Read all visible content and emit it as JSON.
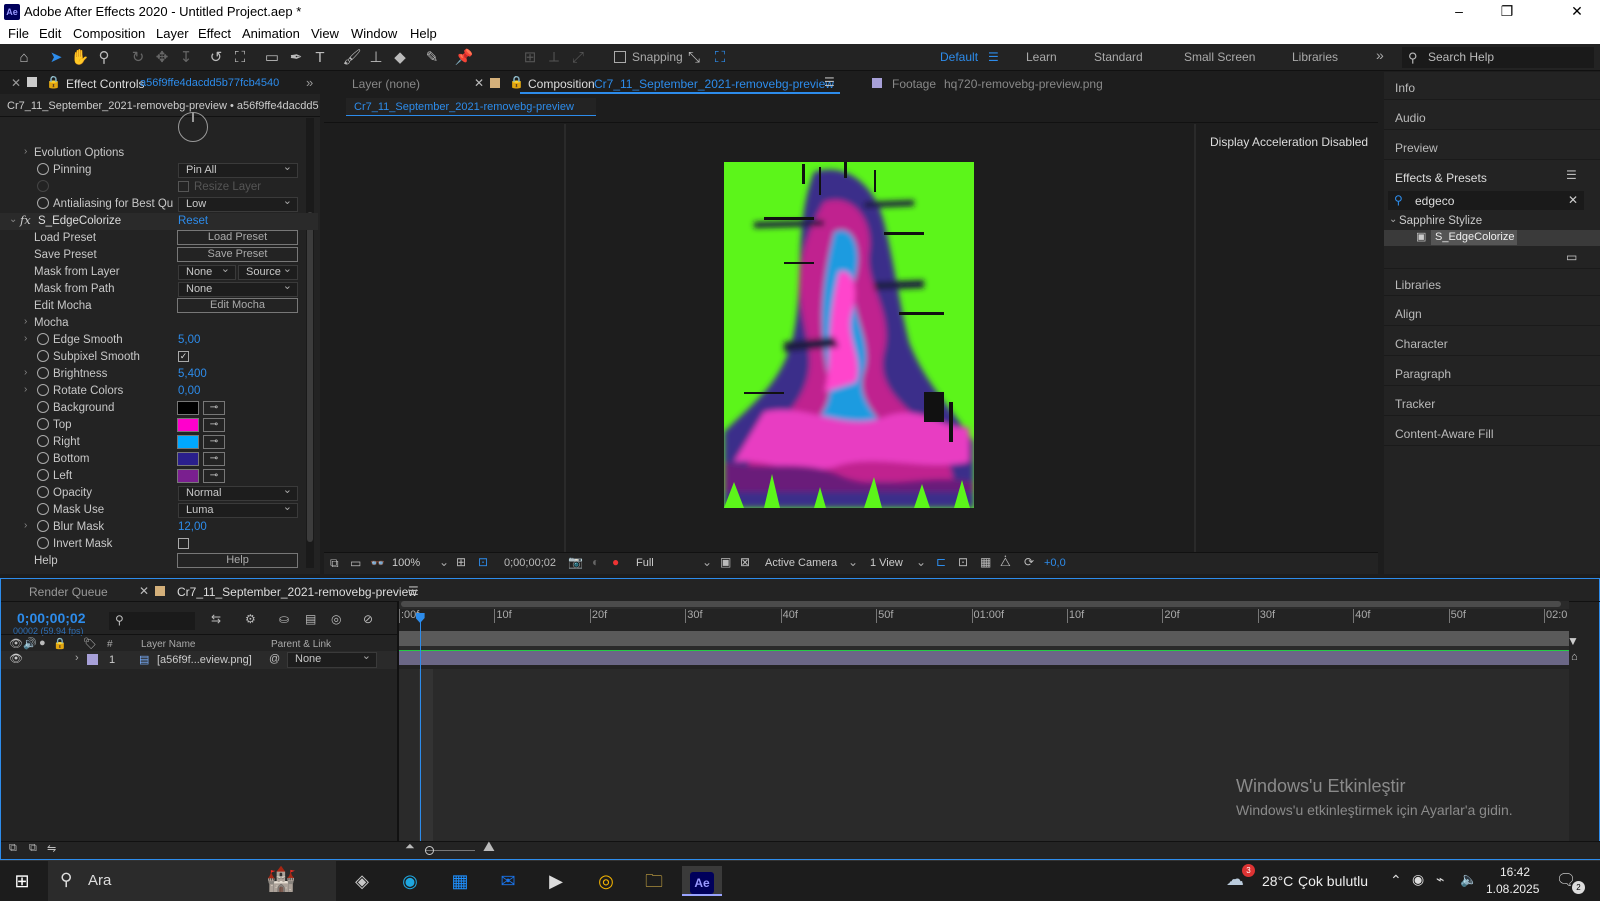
{
  "window": {
    "title": "Adobe After Effects 2020 - Untitled Project.aep *",
    "app_badge": "Ae",
    "minimize": "–",
    "maximize": "❐",
    "close": "✕"
  },
  "menu": [
    "File",
    "Edit",
    "Composition",
    "Layer",
    "Effect",
    "Animation",
    "View",
    "Window",
    "Help"
  ],
  "toolbar": {
    "snapping_label": "Snapping",
    "workspaces": [
      "Default",
      "Learn",
      "Standard",
      "Small Screen",
      "Libraries"
    ],
    "search_help_placeholder": "Search Help",
    "more": "»"
  },
  "effect_controls": {
    "tab_label": "Effect Controls",
    "tab_layer": "a56f9ffe4dacdd5b77fcb4540",
    "header": "Cr7_11_September_2021-removebg-preview • a56f9ffe4dacdd5",
    "rows": {
      "evolution_options": "Evolution Options",
      "pinning": "Pinning",
      "pinning_value": "Pin All",
      "resize_layer": "Resize Layer",
      "antialiasing": "Antialiasing for Best Qu",
      "antialiasing_value": "Low",
      "effect_name": "S_EdgeColorize",
      "reset": "Reset",
      "fx": "fx",
      "load_preset": "Load Preset",
      "save_preset": "Save Preset",
      "mask_from_layer": "Mask from Layer",
      "mask_layer_value": "None",
      "mask_source_value": "Source",
      "mask_from_path": "Mask from Path",
      "mask_path_value": "None",
      "edit_mocha": "Edit Mocha",
      "mocha": "Mocha",
      "edge_smooth": "Edge Smooth",
      "edge_smooth_value": "5,00",
      "subpixel_smooth": "Subpixel Smooth",
      "brightness": "Brightness",
      "brightness_value": "5,400",
      "rotate_colors": "Rotate Colors",
      "rotate_colors_value": "0,00",
      "background": "Background",
      "top": "Top",
      "right": "Right",
      "bottom": "Bottom",
      "left": "Left",
      "opacity": "Opacity",
      "opacity_value": "Normal",
      "mask_use": "Mask Use",
      "mask_use_value": "Luma",
      "blur_mask": "Blur Mask",
      "blur_mask_value": "12,00",
      "invert_mask": "Invert Mask",
      "help": "Help"
    },
    "colors": {
      "background": "#000000",
      "top": "#ff00cc",
      "right": "#00a8ff",
      "bottom": "#2a1f8c",
      "left": "#7a1f8f"
    }
  },
  "viewer": {
    "tab_layer": "Layer (none)",
    "tab_composition_prefix": "Composition",
    "tab_composition_name": "Cr7_11_September_2021-removebg-preview",
    "tab_footage_prefix": "Footage",
    "tab_footage_name": "hq720-removebg-preview.png",
    "subtab": "Cr7_11_September_2021-removebg-preview",
    "display_accel": "Display Acceleration Disabled",
    "zoom": "100%",
    "timecode": "0;00;00;02",
    "resolution": "Full",
    "camera": "Active Camera",
    "views": "1 View",
    "exposure": "+0,0"
  },
  "right_panels": {
    "info": "Info",
    "audio": "Audio",
    "preview": "Preview",
    "effects_presets": "Effects & Presets",
    "search_value": "edgeco",
    "category": "Sapphire Stylize",
    "result": "S_EdgeColorize",
    "libraries": "Libraries",
    "align": "Align",
    "character": "Character",
    "paragraph": "Paragraph",
    "tracker": "Tracker",
    "content_aware_fill": "Content-Aware Fill"
  },
  "timeline": {
    "tab_render_queue": "Render Queue",
    "tab_comp": "Cr7_11_September_2021-removebg-preview",
    "timecode": "0;00;00;02",
    "frame_info": "00002 (59.94 fps)",
    "col_hash": "#",
    "col_layer_name": "Layer Name",
    "col_parent": "Parent & Link",
    "layer_number": "1",
    "layer_name": "[a56f9f...eview.png]",
    "layer_parent": "None",
    "ticks": [
      ":00f",
      "10f",
      "20f",
      "30f",
      "40f",
      "50f",
      "01:00f",
      "10f",
      "20f",
      "30f",
      "40f",
      "50f",
      "02:0"
    ],
    "playhead_fraction": 0.018
  },
  "watermark": {
    "line1": "Windows'u Etkinleştir",
    "line2": "Windows'u etkinleştirmek için Ayarlar'a gidin."
  },
  "taskbar": {
    "search": "Ara",
    "temperature": "28°C",
    "weather": "Çok bulutlu",
    "weather_badge": "3",
    "time": "16:42",
    "date": "1.08.2025",
    "notifications": "2",
    "active_app": "Ae"
  }
}
